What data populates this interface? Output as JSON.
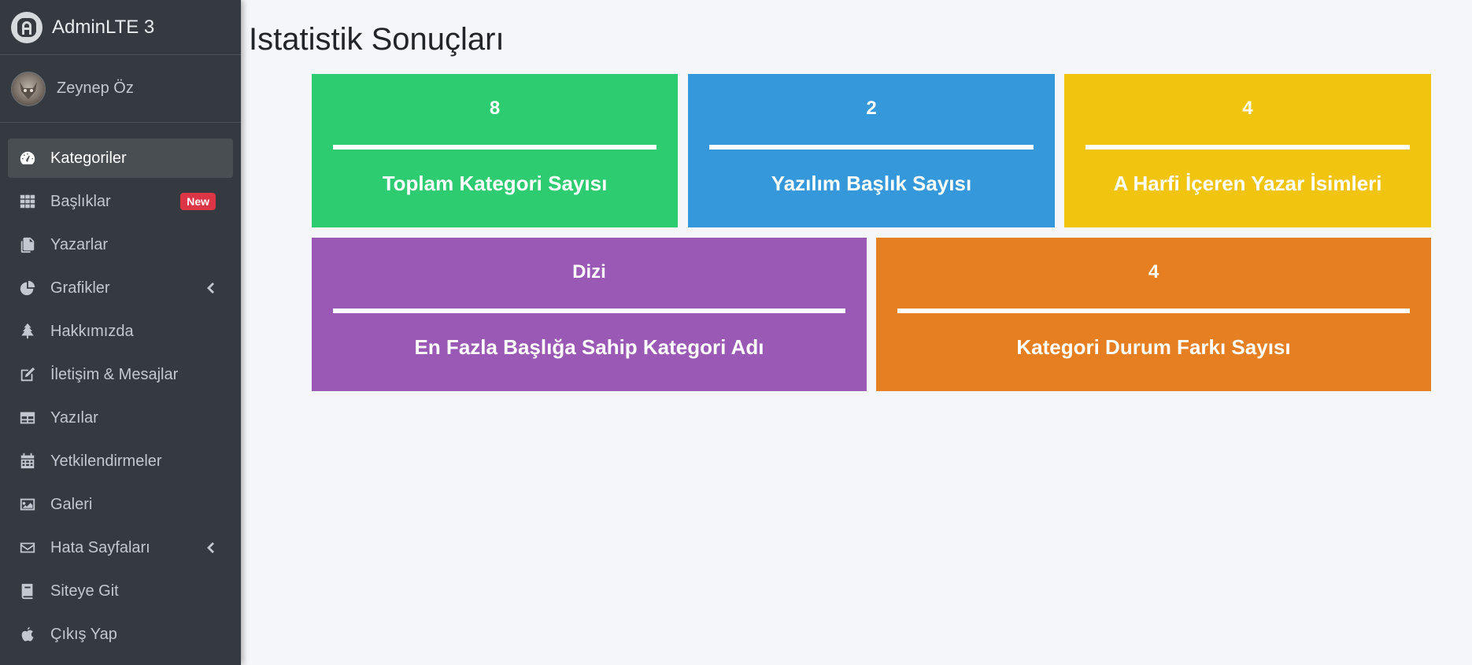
{
  "brand": {
    "name": "AdminLTE 3",
    "logo_icon": "adminlte-logo-icon"
  },
  "user": {
    "name": "Zeynep Öz"
  },
  "nav": [
    {
      "label": "Kategoriler",
      "icon": "dashboard-gauge-icon",
      "active": true
    },
    {
      "label": "Başlıklar",
      "icon": "grid-icon",
      "badge": "New"
    },
    {
      "label": "Yazarlar",
      "icon": "copy-icon"
    },
    {
      "label": "Grafikler",
      "icon": "pie-chart-icon",
      "submenu": true
    },
    {
      "label": "Hakkımızda",
      "icon": "tree-icon"
    },
    {
      "label": "İletişim & Mesajlar",
      "icon": "edit-icon"
    },
    {
      "label": "Yazılar",
      "icon": "table-icon"
    },
    {
      "label": "Yetkilendirmeler",
      "icon": "calendar-icon"
    },
    {
      "label": "Galeri",
      "icon": "image-icon"
    },
    {
      "label": "Hata Sayfaları",
      "icon": "envelope-icon",
      "submenu": true
    },
    {
      "label": "Siteye Git",
      "icon": "book-icon"
    },
    {
      "label": "Çıkış Yap",
      "icon": "apple-icon"
    }
  ],
  "page": {
    "title": "Istatistik Sonuçları"
  },
  "stats": [
    {
      "value": "8",
      "label": "Toplam Kategori Sayısı",
      "color": "#2ecc71"
    },
    {
      "value": "2",
      "label": "Yazılım Başlık Sayısı",
      "color": "#3498db"
    },
    {
      "value": "4",
      "label": "A Harfi İçeren Yazar İsimleri",
      "color": "#f1c40f"
    },
    {
      "value": "Dizi",
      "label": "En Fazla Başlığa Sahip Kategori Adı",
      "color": "#9b59b6"
    },
    {
      "value": "4",
      "label": "Kategori Durum Farkı Sayısı",
      "color": "#e67e22"
    }
  ]
}
